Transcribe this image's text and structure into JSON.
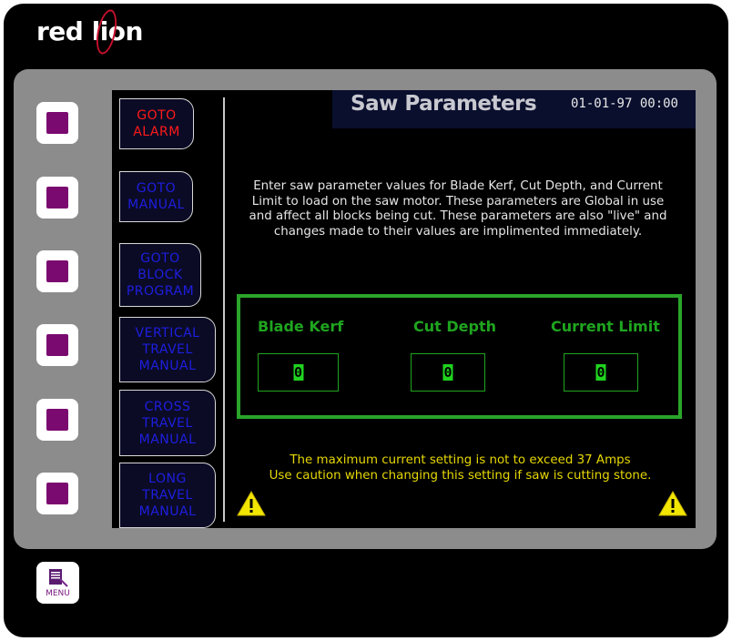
{
  "brand": {
    "name": "red lion"
  },
  "screen": {
    "title": "Saw Parameters",
    "datetime": "01-01-97 00:00",
    "nav_buttons": [
      {
        "label": "GOTO\nALARM",
        "color": "#ff1a1a"
      },
      {
        "label": "GOTO\nMANUAL",
        "color": "#1e1ee0"
      },
      {
        "label": "GOTO\nBLOCK\nPROGRAM",
        "color": "#1e1ee0"
      },
      {
        "label": "VERTICAL\nTRAVEL\nMANUAL",
        "color": "#1e1ee0"
      },
      {
        "label": "CROSS\nTRAVEL\nMANUAL",
        "color": "#1e1ee0"
      },
      {
        "label": "LONG\nTRAVEL\nMANUAL",
        "color": "#1e1ee0"
      }
    ],
    "instructions": "Enter saw parameter values for Blade Kerf, Cut Depth, and Current Limit to load on the saw motor. These parameters are Global in use and affect all blocks being cut. These parameters are also \"live\" and changes made to their values are implimented immediately.",
    "parameters": [
      {
        "label": "Blade Kerf",
        "value": "0"
      },
      {
        "label": "Cut Depth",
        "value": "0"
      },
      {
        "label": "Current Limit",
        "value": "0"
      }
    ],
    "warning": "The maximum current setting is not to exceed 37 Amps\n Use caution when changing this setting if saw is cutting stone.",
    "warning_icon": "warning-triangle-icon"
  },
  "hardware": {
    "softkeys": 6,
    "menu_label": "MENU"
  },
  "colors": {
    "accent_green": "#1fa51f",
    "warning_yellow": "#e6d800",
    "softkey_purple": "#7a0a70",
    "logo_red": "#c8102e"
  }
}
